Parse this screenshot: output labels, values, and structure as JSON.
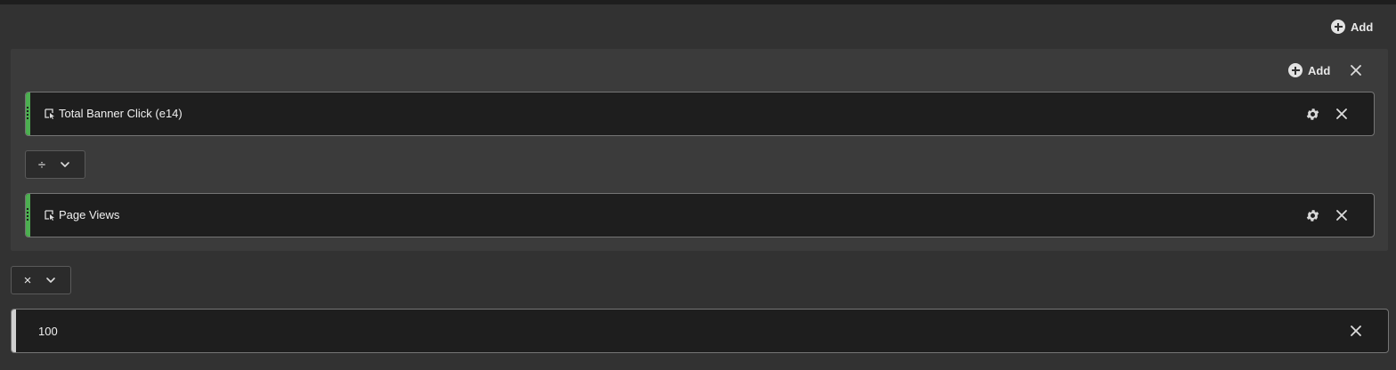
{
  "toolbar": {
    "add_label": "Add"
  },
  "container": {
    "add_label": "Add",
    "metrics": [
      {
        "label": "Total Banner Click (e14)",
        "icon": "metric-icon",
        "accent": "#4caf50"
      },
      {
        "label": "Page Views",
        "icon": "metric-icon",
        "accent": "#4caf50"
      }
    ],
    "operator": {
      "symbol": "÷"
    }
  },
  "outer_operator": {
    "symbol": "×"
  },
  "constant": {
    "value": "100",
    "accent": "#d0d0d0"
  }
}
